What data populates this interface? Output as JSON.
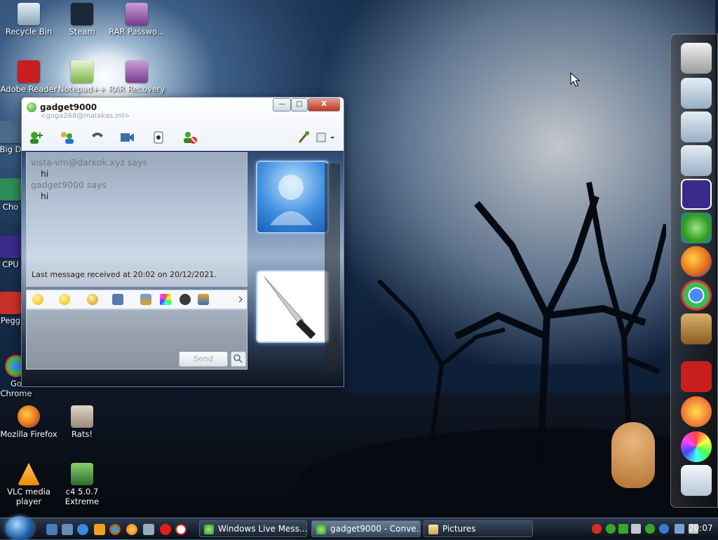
{
  "desktop": {
    "icons": [
      {
        "label": "Recycle Bin",
        "color": "#8aa3b8"
      },
      {
        "label": "Steam",
        "color": "#1b2838"
      },
      {
        "label": "RAR Passwo...",
        "color": "#7a3c8c"
      },
      {
        "label": "Adobe Reader",
        "color": "#c91e1e"
      },
      {
        "label": "Notepad++",
        "color": "#7fb64a"
      },
      {
        "label": "RAR Recovery",
        "color": "#7a3c8c"
      },
      {
        "label": "Big D",
        "color": "#4a6a8a"
      },
      {
        "label": "Cho",
        "color": "#2e8b57"
      },
      {
        "label": "CPU",
        "color": "#3a2a8a"
      },
      {
        "label": "Pegg",
        "color": "#c8302a"
      },
      {
        "label": "Go Chrome",
        "color": "#3cba54"
      },
      {
        "label": "Mozilla Firefox",
        "color": "#e86f1a"
      },
      {
        "label": "Rats!",
        "color": "#9a8a7a"
      },
      {
        "label": "VLC media player",
        "color": "#f08a00"
      },
      {
        "label": "c4 5.0.7 Extreme",
        "color": "#2e6b2e"
      }
    ]
  },
  "messenger": {
    "title": "gadget9000",
    "subtitle": "<goga268@malakas.ml>",
    "controls": {
      "minimize": "—",
      "maximize": "□",
      "close": "X"
    },
    "conversation": [
      {
        "sender": "vista-vm@darkok.xyz says",
        "text": "hi"
      },
      {
        "sender": "gadget9000 says",
        "text": "hi"
      }
    ],
    "last_message": "Last message received at 20:02 on 20/12/2021.",
    "send_label": "Send"
  },
  "taskbar": {
    "tasks": [
      {
        "label": "Windows Live Mess...",
        "active": false
      },
      {
        "label": "gadget9000 - Conve...",
        "active": true
      },
      {
        "label": "Pictures",
        "active": false
      }
    ],
    "clock": "20:07"
  }
}
